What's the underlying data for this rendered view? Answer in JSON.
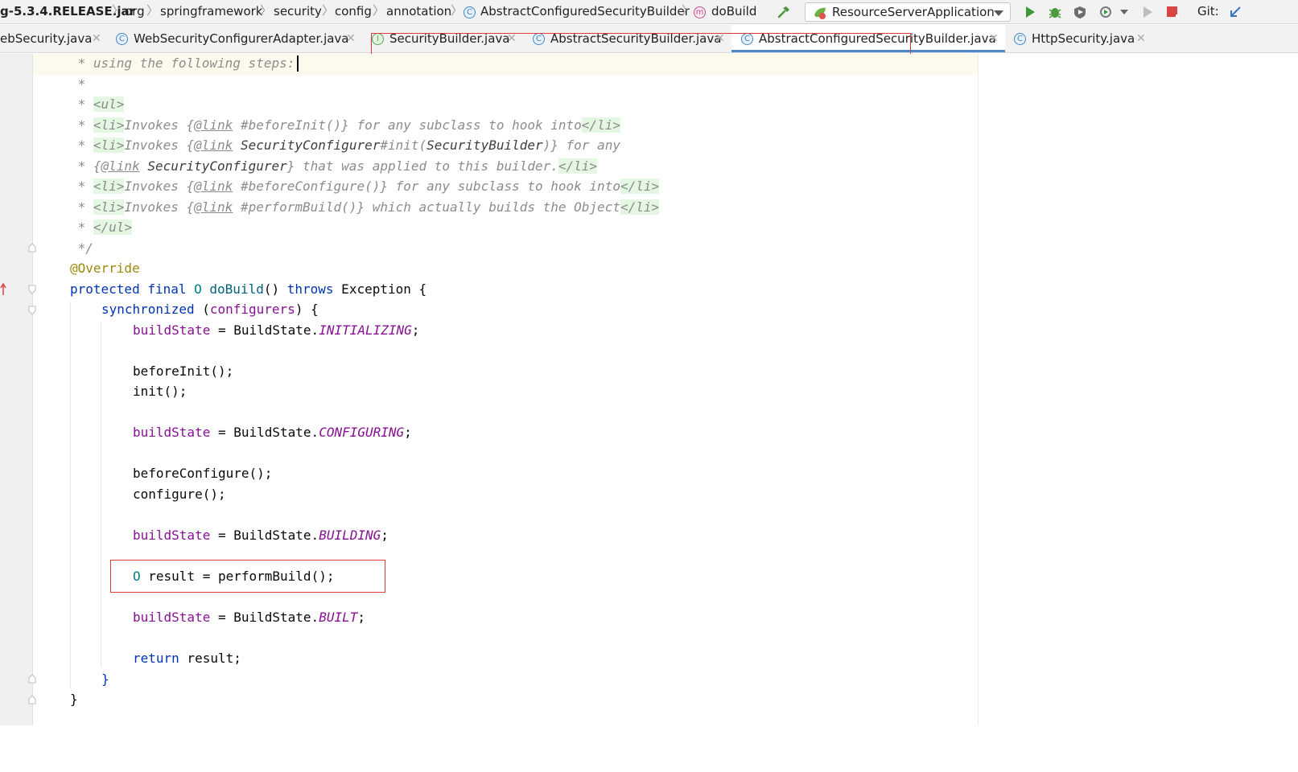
{
  "breadcrumb": {
    "items": [
      "g-5.3.4.RELEASE.jar",
      "org",
      "springframework",
      "security",
      "config",
      "annotation",
      "AbstractConfiguredSecurityBuilder",
      "doBuild"
    ]
  },
  "toolbar": {
    "run_config": "ResourceServerApplication",
    "git_label": "Git:"
  },
  "tabs": [
    {
      "label": "ebSecurity.java",
      "icon": "class-icon",
      "active": false
    },
    {
      "label": "WebSecurityConfigurerAdapter.java",
      "icon": "class-icon",
      "active": false
    },
    {
      "label": "SecurityBuilder.java",
      "icon": "interface-icon",
      "active": false
    },
    {
      "label": "AbstractSecurityBuilder.java",
      "icon": "class-icon",
      "active": false
    },
    {
      "label": "AbstractConfiguredSecurityBuilder.java",
      "icon": "class-icon",
      "active": true
    },
    {
      "label": "HttpSecurity.java",
      "icon": "class-icon",
      "active": false
    }
  ],
  "icon_glyphs": {
    "class": "C",
    "interface": "I",
    "method": "m"
  },
  "colors": {
    "keyword": "#0033b3",
    "field": "#871094",
    "annotation": "#9e880d",
    "highlight_box": "#e03a3a",
    "active_tab_underline": "#4a88c7"
  },
  "code": {
    "l01": {
      "a": " * using the following steps:"
    },
    "l02": {
      "a": " *"
    },
    "l03": {
      "a": " * ",
      "b": "<ul>"
    },
    "l04": {
      "a": " * ",
      "b": "<li>",
      "c": "Invokes {",
      "d": "@link",
      "e": " #beforeInit()} for any subclass to hook into",
      "f": "</li>"
    },
    "l05": {
      "a": " * ",
      "b": "<li>",
      "c": "Invokes {",
      "d": "@link",
      "e": " ",
      "f": "SecurityConfigurer",
      "g": "#init(",
      "h": "SecurityBuilder",
      "i": ")} for any"
    },
    "l06": {
      "a": " * {",
      "b": "@link",
      "c": " ",
      "d": "SecurityConfigurer",
      "e": "} that was applied to this builder.",
      "f": "</li>"
    },
    "l07": {
      "a": " * ",
      "b": "<li>",
      "c": "Invokes {",
      "d": "@link",
      "e": " #beforeConfigure()} for any subclass to hook into",
      "f": "</li>"
    },
    "l08": {
      "a": " * ",
      "b": "<li>",
      "c": "Invokes {",
      "d": "@link",
      "e": " #performBuild()} which actually builds the Object",
      "f": "</li>"
    },
    "l09": {
      "a": " * ",
      "b": "</ul>"
    },
    "l10": {
      "a": " */"
    },
    "l11": {
      "a": "@Override"
    },
    "l12": {
      "a": "protected final ",
      "b": "O",
      "c": " ",
      "d": "doBuild",
      "e": "() ",
      "f": "throws",
      "g": " Exception {"
    },
    "l13": {
      "a": "synchronized",
      "b": " (",
      "c": "configurers",
      "d": ") {"
    },
    "l14": {
      "a": "buildState",
      "b": " = BuildState.",
      "c": "INITIALIZING",
      "d": ";"
    },
    "l15": {
      "a": "beforeInit();"
    },
    "l16": {
      "a": "init();"
    },
    "l17": {
      "a": "buildState",
      "b": " = BuildState.",
      "c": "CONFIGURING",
      "d": ";"
    },
    "l18": {
      "a": "beforeConfigure();"
    },
    "l19": {
      "a": "configure();"
    },
    "l20": {
      "a": "buildState",
      "b": " = BuildState.",
      "c": "BUILDING",
      "d": ";"
    },
    "l21": {
      "a": "O",
      "b": " result = performBuild();"
    },
    "l22": {
      "a": "buildState",
      "b": " = BuildState.",
      "c": "BUILT",
      "d": ";"
    },
    "l23": {
      "a": "return",
      "b": " result;"
    },
    "l24": {
      "a": "}"
    },
    "l25": {
      "a": "}"
    }
  }
}
